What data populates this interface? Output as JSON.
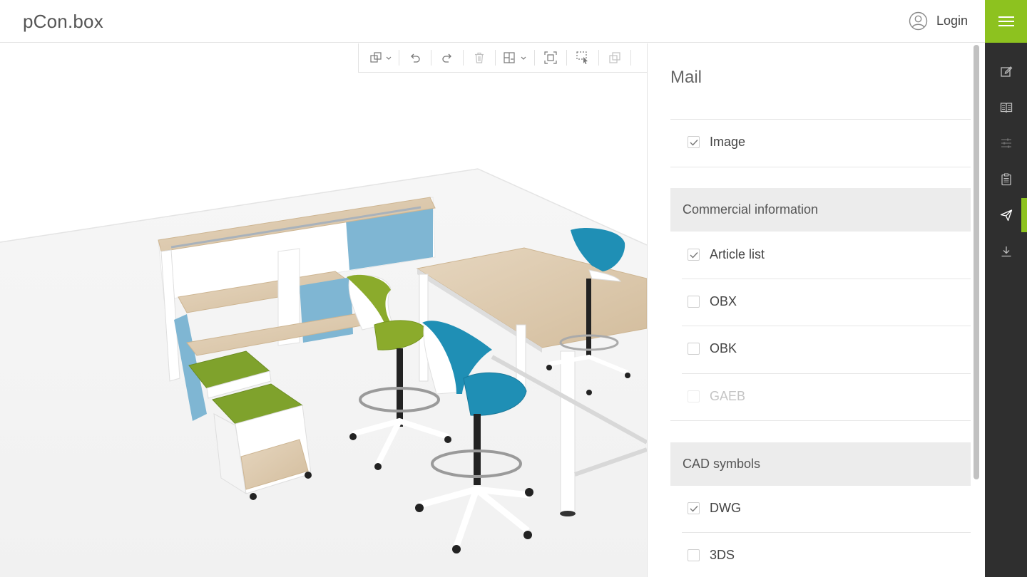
{
  "app": {
    "brand": "pCon.box"
  },
  "header": {
    "login_label": "Login"
  },
  "icons": {
    "user": "user-circle-icon",
    "menu": "hamburger-menu-icon",
    "rail": [
      "edit-icon",
      "catalog-book-icon",
      "sliders-icon",
      "clipboard-list-icon",
      "send-icon",
      "download-icon"
    ]
  },
  "toolbar": {
    "tools": [
      "insert-article-icon",
      "undo-icon",
      "redo-icon",
      "delete-icon",
      "layout-grid-icon",
      "zoom-fit-icon",
      "select-area-icon",
      "copy-icon"
    ]
  },
  "panel": {
    "title": "Mail",
    "image": {
      "label": "Image",
      "checked": true
    },
    "commercial": {
      "heading": "Commercial information",
      "options": [
        {
          "label": "Article list",
          "checked": true,
          "disabled": false
        },
        {
          "label": "OBX",
          "checked": false,
          "disabled": false
        },
        {
          "label": "OBK",
          "checked": false,
          "disabled": false
        },
        {
          "label": "GAEB",
          "checked": false,
          "disabled": true
        }
      ]
    },
    "cad": {
      "heading": "CAD symbols",
      "options": [
        {
          "label": "DWG",
          "checked": true,
          "disabled": false
        },
        {
          "label": "3DS",
          "checked": false,
          "disabled": false
        }
      ]
    }
  },
  "colors": {
    "accent": "#8dc21f",
    "rail": "#2f2f2f",
    "section": "#ececec"
  }
}
